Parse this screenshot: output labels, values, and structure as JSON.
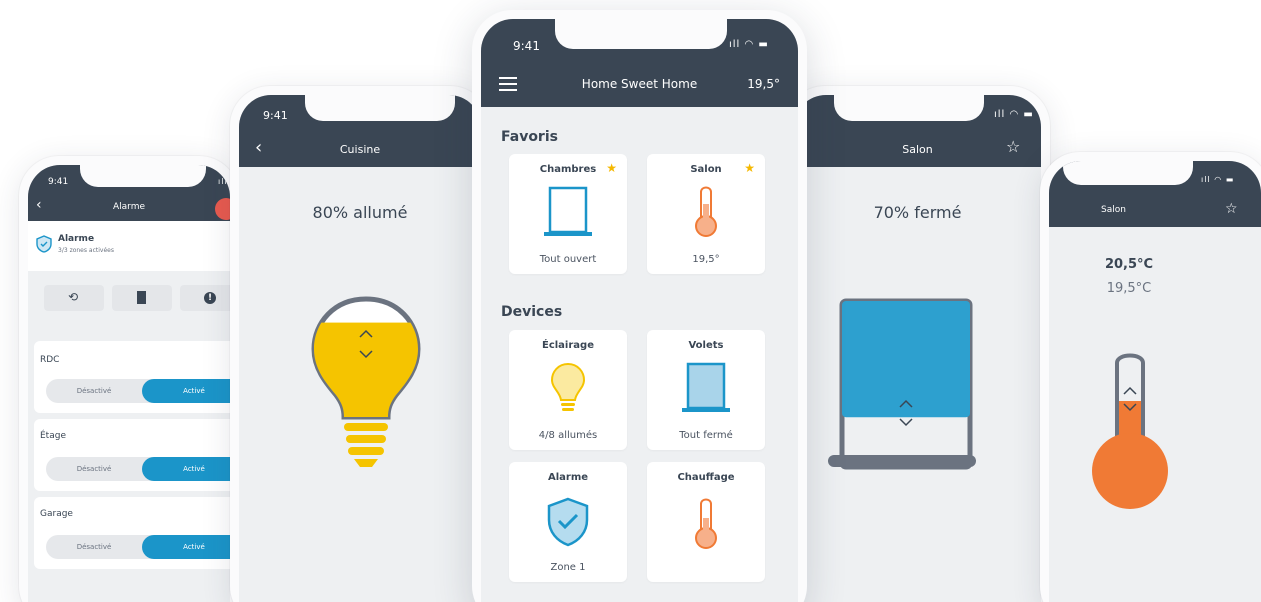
{
  "colors": {
    "topbar": "#3a4654",
    "accent_blue": "#1b95c9",
    "bulb_yellow": "#f5c400",
    "heat_orange": "#f07a35",
    "star": "#f5b800"
  },
  "phone_alarm": {
    "time": "9:41",
    "title": "Alarme",
    "status_title": "Alarme",
    "status_sub": "3/3 zones activées",
    "zones": [
      {
        "name": "RDC",
        "off_label": "Désactivé",
        "on_label": "Activé"
      },
      {
        "name": "Étage",
        "off_label": "Désactivé",
        "on_label": "Activé"
      },
      {
        "name": "Garage",
        "off_label": "Désactivé",
        "on_label": "Activé"
      }
    ]
  },
  "phone_cuisine": {
    "time": "9:41",
    "title": "Cuisine",
    "status": "80% allumé",
    "level": 0.8
  },
  "phone_home": {
    "time": "9:41",
    "title": "Home Sweet Home",
    "temperature": "19,5°",
    "favorites_heading": "Favoris",
    "devices_heading": "Devices",
    "favorites": [
      {
        "title": "Chambres",
        "sub": "Tout ouvert",
        "icon": "window-open-icon"
      },
      {
        "title": "Salon",
        "sub": "19,5°",
        "icon": "thermometer-icon"
      }
    ],
    "devices": [
      {
        "title": "Éclairage",
        "sub": "4/8 allumés",
        "icon": "bulb-icon"
      },
      {
        "title": "Volets",
        "sub": "Tout fermé",
        "icon": "shutter-icon"
      },
      {
        "title": "Alarme",
        "sub": "Zone 1",
        "icon": "shield-check-icon"
      },
      {
        "title": "Chauffage",
        "sub": "",
        "icon": "thermometer-icon"
      }
    ]
  },
  "phone_salon_volets": {
    "title": "Salon",
    "status": "70% fermé",
    "level": 0.7
  },
  "phone_salon_temp": {
    "title": "Salon",
    "target": "20,5°C",
    "current": "19,5°C"
  }
}
